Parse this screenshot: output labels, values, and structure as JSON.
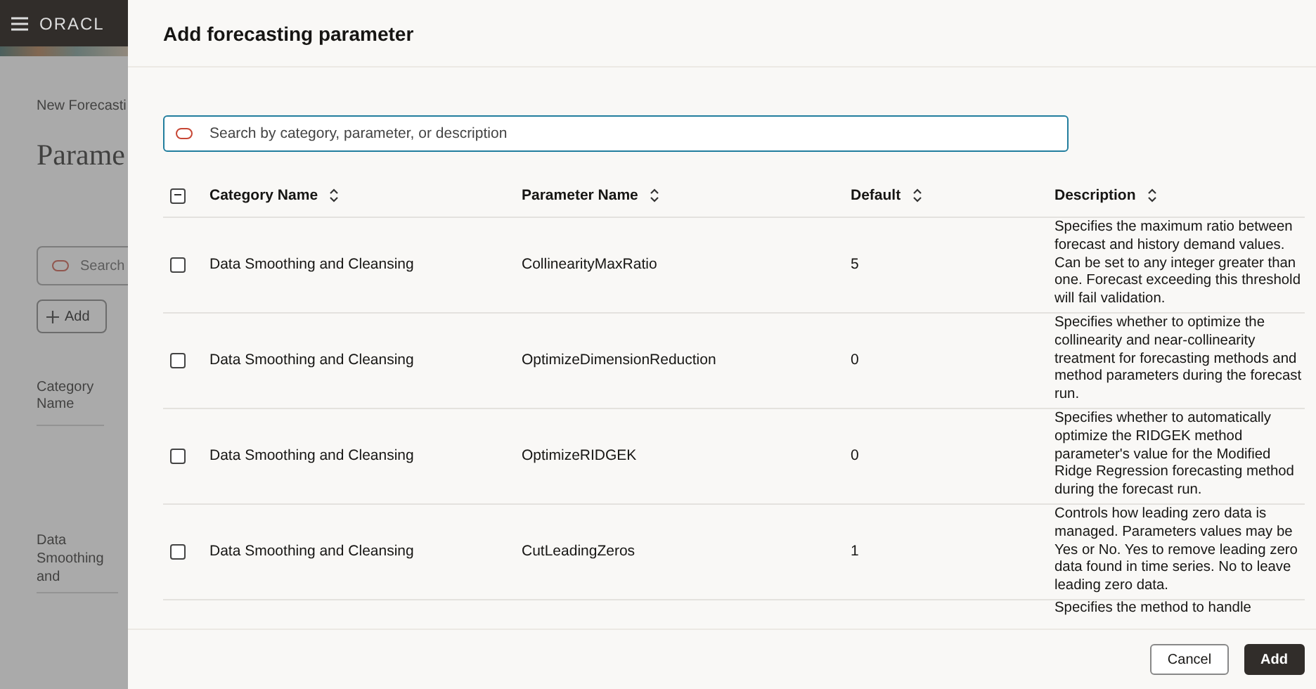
{
  "background": {
    "logo": "ORACL",
    "breadcrumb": "New Forecasti",
    "heading": "Parame",
    "search": {
      "placeholder": "Search"
    },
    "add_button": "Add",
    "column_header": "Category Name",
    "cell": "Data Smoothing and"
  },
  "drawer": {
    "title": "Add forecasting parameter",
    "search": {
      "placeholder": "Search by category, parameter, or description"
    },
    "select_all": {
      "indeterminate": true
    },
    "columns": [
      "Category Name",
      "Parameter Name",
      "Default",
      "Description"
    ],
    "rows": [
      {
        "selected": false,
        "category": "Data Smoothing and Cleansing",
        "parameter": "CollinearityMaxRatio",
        "default": "5",
        "description": "Specifies the maximum ratio between forecast and history demand values. Can be set to any integer greater than one. Forecast exceeding this threshold will fail validation."
      },
      {
        "selected": false,
        "category": "Data Smoothing and Cleansing",
        "parameter": "OptimizeDimensionReduction",
        "default": "0",
        "description": "Specifies whether to optimize the collinearity and near-collinearity treatment for forecasting methods and method parameters during the forecast run."
      },
      {
        "selected": false,
        "category": "Data Smoothing and Cleansing",
        "parameter": "OptimizeRIDGEK",
        "default": "0",
        "description": "Specifies whether to automatically optimize the RIDGEK method parameter's value for the Modified Ridge Regression forecasting method during the forecast run."
      },
      {
        "selected": false,
        "category": "Data Smoothing and Cleansing",
        "parameter": "CutLeadingZeros",
        "default": "1",
        "description": "Controls how leading zero data is managed. Parameters values may be Yes or No. Yes to remove leading zero data found in time series. No to leave leading zero data."
      }
    ],
    "partial_row": {
      "description": "Specifies the method to handle"
    },
    "buttons": [
      {
        "label": "Cancel",
        "kind": "secondary"
      },
      {
        "label": "Add",
        "kind": "primary"
      }
    ]
  }
}
